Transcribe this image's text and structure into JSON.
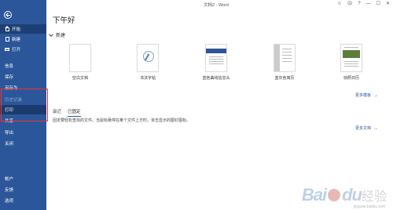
{
  "window": {
    "title": "文档2 - Word",
    "controls": {
      "smiley": "☺",
      "sad": "☹",
      "help": "?",
      "minimize": "—",
      "maximize": "☐",
      "close": "✕"
    }
  },
  "sidebar": {
    "items": [
      {
        "label": "开始",
        "icon": "home-icon"
      },
      {
        "label": "新建",
        "icon": "new-doc-icon"
      },
      {
        "label": "打开",
        "icon": "open-folder-icon"
      },
      {
        "label": "信息"
      },
      {
        "label": "保存"
      },
      {
        "label": "另存为"
      },
      {
        "label": "历史记录"
      },
      {
        "label": "打印"
      },
      {
        "label": "共享"
      },
      {
        "label": "导出"
      },
      {
        "label": "关闭"
      },
      {
        "label": "帐户"
      },
      {
        "label": "反馈"
      },
      {
        "label": "选项"
      }
    ],
    "colors": {
      "background": "#2b579a",
      "active": "#1e3f75",
      "highlight_box": "#e33333"
    }
  },
  "main": {
    "greeting": "下午好",
    "new_section_label": "新建",
    "templates": [
      {
        "label": "空白文档",
        "thumb": "blank"
      },
      {
        "label": "书法字帖",
        "thumb": "calligraphy"
      },
      {
        "label": "蓝色曲线信息头",
        "thumb": "blue-curve"
      },
      {
        "label": "蓝灰色简历",
        "thumb": "resume"
      },
      {
        "label": "快照日历",
        "thumb": "calendar"
      }
    ],
    "more_templates": "更多模板",
    "tabs": [
      {
        "label": "最近"
      },
      {
        "label": "已固定"
      }
    ],
    "active_tab": "已固定",
    "pinned_empty_message": "固定要轻松查找的文件。当鼠标悬停在某个文件上方时，单击显示的图钉图标。",
    "more_docs": "更多文档"
  },
  "watermark": {
    "brand": "Bai",
    "brand_suffix": "du",
    "cn": "经验",
    "url": "jingyan.baidu.com"
  }
}
